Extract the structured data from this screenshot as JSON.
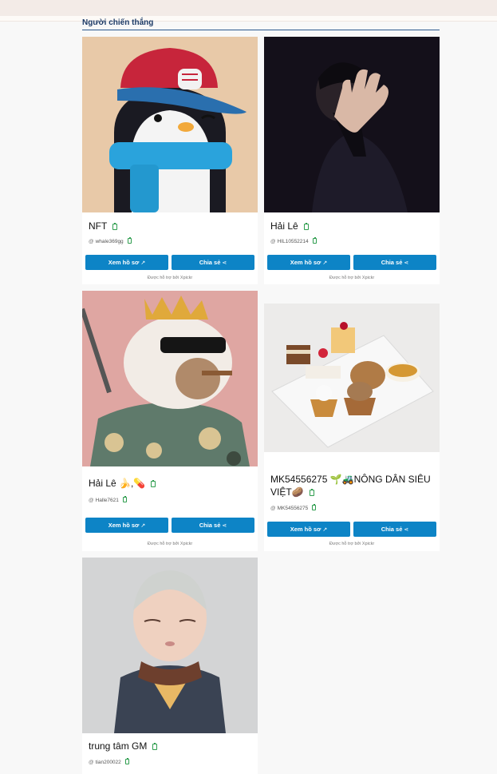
{
  "section": {
    "title": "Người chiến thắng"
  },
  "cards": [
    {
      "name": "NFT",
      "username": "whale369gg",
      "view_label": "Xem hồ sơ",
      "share_label": "Chia sẻ",
      "powered_by": "Được hỗ trợ bởi Xpickr",
      "image": "penguin-nft-avatar"
    },
    {
      "name": "Hải Lê",
      "username": "HIL10552214",
      "view_label": "Xem hồ sơ",
      "share_label": "Chia sẻ",
      "powered_by": "Được hỗ trợ bởi Xpickr",
      "image": "man-raising-hand-photo"
    },
    {
      "name": "Hải Lê 🍌,💊",
      "username": "Halle7621",
      "view_label": "Xem hồ sơ",
      "share_label": "Chia sẻ",
      "powered_by": "Được hỗ trợ bởi Xpickr",
      "image": "capybara-king-avatar"
    },
    {
      "name": "MK54556275 🌱🚜NÔNG DÂN SIÊU VIỆT🥔",
      "username": "MK54556275",
      "view_label": "Xem hồ sơ",
      "share_label": "Chia sẻ",
      "powered_by": "Được hỗ trợ bởi Xpickr",
      "image": "dessert-plate-photo"
    },
    {
      "name": "trung tâm GM",
      "username": "tian200022",
      "image": "monk-3d-avatar"
    }
  ],
  "colors": {
    "button": "#0d84c6",
    "copy_icon": "#2e9d4e",
    "title": "#1c3a66"
  }
}
